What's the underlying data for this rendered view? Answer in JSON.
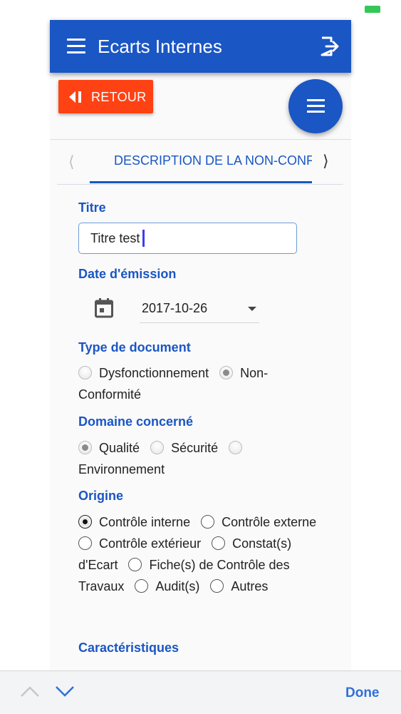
{
  "app": {
    "title": "Ecarts Internes"
  },
  "actions": {
    "back_label": "RETOUR"
  },
  "tabs": {
    "current": "DESCRIPTION DE LA NON-CONFORMITÉ",
    "prev_icon": "chevron-left-icon",
    "next_icon": "chevron-right-icon"
  },
  "form": {
    "titre": {
      "label": "Titre",
      "value": "Titre test"
    },
    "date": {
      "label": "Date d'émission",
      "value": "2017-10-26"
    },
    "type_document": {
      "label": "Type de document",
      "options": [
        {
          "label": "Dysfonctionnement",
          "selected": false
        },
        {
          "label": "Non-Conformité",
          "selected": true
        }
      ]
    },
    "domaine": {
      "label": "Domaine concerné",
      "options": [
        {
          "label": "Qualité",
          "selected": true
        },
        {
          "label": "Sécurité",
          "selected": false
        },
        {
          "label": "Environnement",
          "selected": false
        }
      ]
    },
    "origine": {
      "label": "Origine",
      "options": [
        {
          "label": "Contrôle interne",
          "selected": true
        },
        {
          "label": "Contrôle externe",
          "selected": false
        },
        {
          "label": "Contrôle extérieur",
          "selected": false
        },
        {
          "label": "Constat(s) d'Ecart",
          "selected": false
        },
        {
          "label": "Fiche(s) de Contrôle des Travaux",
          "selected": false
        },
        {
          "label": "Audit(s)",
          "selected": false
        },
        {
          "label": "Autres",
          "selected": false
        }
      ]
    },
    "caracteristiques": {
      "label": "Caractéristiques"
    }
  },
  "keyboard_toolbar": {
    "done_label": "Done"
  },
  "colors": {
    "primary": "#1a56c4",
    "back_button": "#ff4214",
    "done": "#2f6fd8",
    "battery": "#35c759"
  }
}
